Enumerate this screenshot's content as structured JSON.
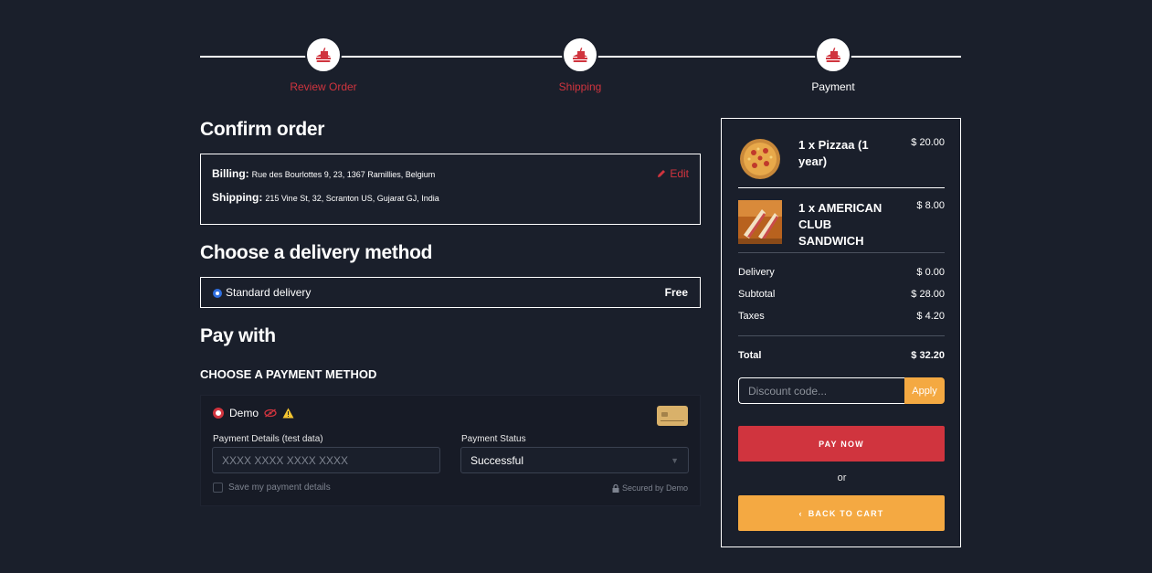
{
  "steps": [
    {
      "label": "Review Order",
      "state": "done"
    },
    {
      "label": "Shipping",
      "state": "done"
    },
    {
      "label": "Payment",
      "state": "active"
    }
  ],
  "confirm": {
    "title": "Confirm order",
    "billing_label": "Billing:",
    "billing_value": "Rue des Bourlottes 9, 23, 1367 Ramillies, Belgium",
    "shipping_label": "Shipping:",
    "shipping_value": "215 Vine St, 32, Scranton US, Gujarat GJ, India",
    "edit_label": "Edit"
  },
  "delivery": {
    "title": "Choose a delivery method",
    "option_label": "Standard delivery",
    "option_price": "Free"
  },
  "payment": {
    "title": "Pay with",
    "subtitle": "CHOOSE A PAYMENT METHOD",
    "method_name": "Demo",
    "details_label": "Payment Details (test data)",
    "card_placeholder": "XXXX XXXX XXXX XXXX",
    "status_label": "Payment Status",
    "status_value": "Successful",
    "save_label": "Save my payment details",
    "secured_label": "Secured by Demo"
  },
  "summary": {
    "items": [
      {
        "name": "1 x Pizzaa (1 year)",
        "price": "$ 20.00"
      },
      {
        "name": "1 x AMERICAN CLUB SANDWICH",
        "price": "$ 8.00"
      }
    ],
    "delivery_label": "Delivery",
    "delivery_value": "$ 0.00",
    "subtotal_label": "Subtotal",
    "subtotal_value": "$ 28.00",
    "taxes_label": "Taxes",
    "taxes_value": "$ 4.20",
    "total_label": "Total",
    "total_value": "$ 32.20",
    "discount_placeholder": "Discount code...",
    "apply_label": "Apply",
    "pay_label": "PAY NOW",
    "or_label": "or",
    "back_label": "BACK TO CART"
  },
  "colors": {
    "accent_red": "#d0343e",
    "accent_orange": "#f4a942",
    "background": "#1a1f2b"
  }
}
